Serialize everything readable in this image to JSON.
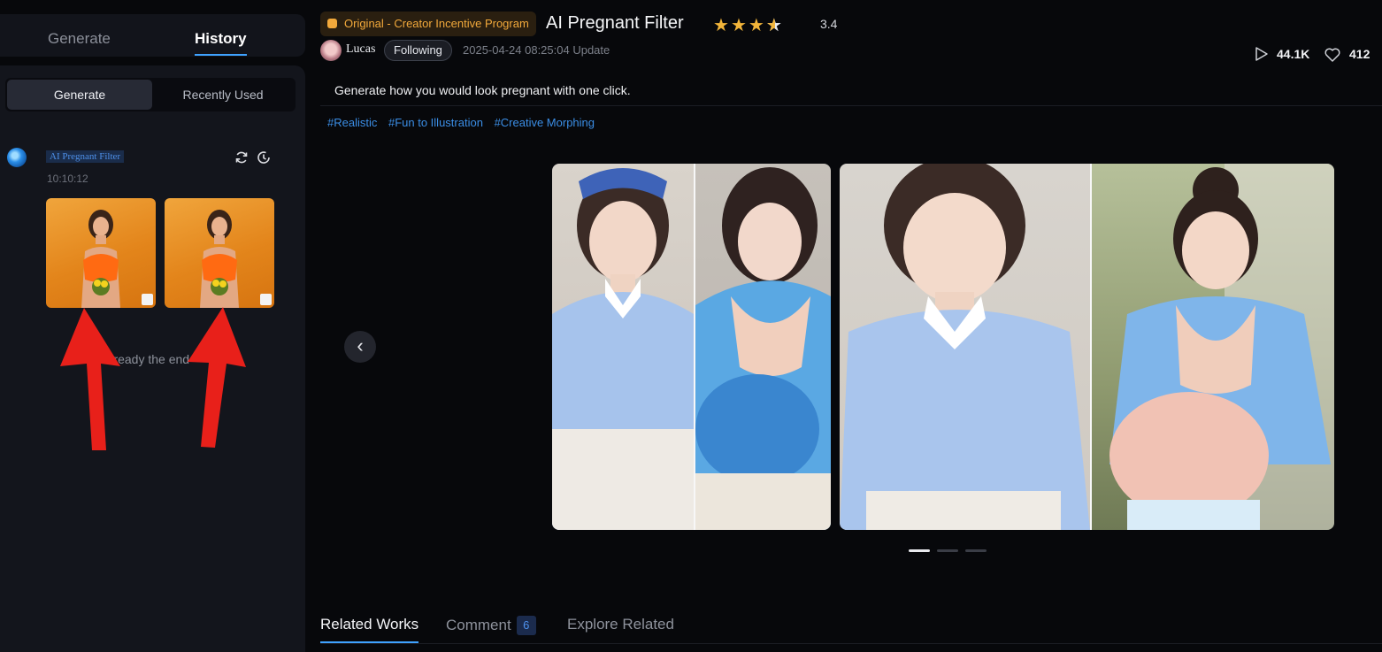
{
  "sidebar": {
    "top_tabs": [
      "Generate",
      "History"
    ],
    "segment": [
      "Generate",
      "Recently Used"
    ],
    "history_item": {
      "tag": "AI Pregnant Filter",
      "time": "10:10:12",
      "thumbnails": [
        "generated-image-1",
        "generated-image-2"
      ]
    },
    "end_text": "Already the end"
  },
  "header": {
    "badge": "Original - Creator Incentive Program",
    "title": "AI Pregnant Filter",
    "rating": "3.4",
    "stars": 3.5,
    "author": "Lucas",
    "follow_label": "Following",
    "updated": "2025-04-24 08:25:04 Update",
    "plays": "44.1K",
    "likes": "412"
  },
  "description": "Generate how you would look pregnant with one click.",
  "tags": [
    "#Realistic",
    "#Fun to Illustration",
    "#Creative Morphing"
  ],
  "carousel": {
    "slides": [
      "before-after-sample-1",
      "before-after-sample-2"
    ],
    "page_count": 3,
    "active_page": 1
  },
  "bottom_tabs": {
    "related": "Related Works",
    "comment": "Comment",
    "comment_count": "6",
    "explore": "Explore Related"
  },
  "colors": {
    "accent": "#3fa2ff",
    "star": "#f2b53a",
    "badge_text": "#f2a93b",
    "annotation_arrow": "#e8201a"
  },
  "icons": [
    "refresh-icon",
    "clock-icon",
    "edit-icon",
    "play-icon",
    "heart-icon",
    "chevron-left-icon"
  ]
}
